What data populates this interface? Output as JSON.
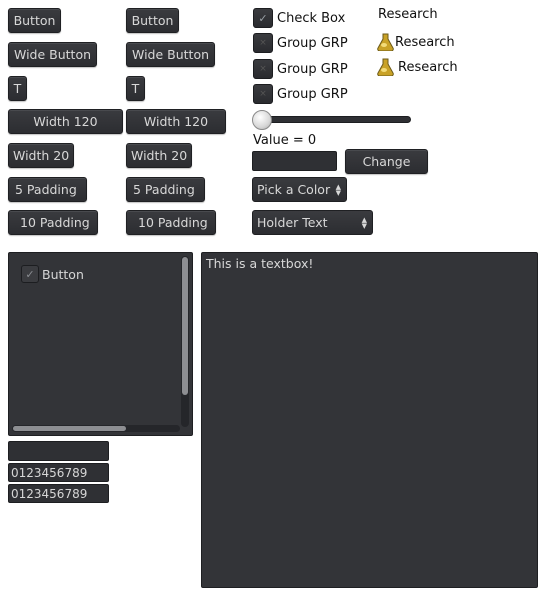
{
  "col1": {
    "button": "Button",
    "wide_button": "Wide Button",
    "t_button": "T",
    "width120": "Width 120",
    "width20": "Width 20",
    "padding5": "5 Padding",
    "padding10": "10 Padding"
  },
  "col2": {
    "button": "Button",
    "wide_button": "Wide Button",
    "t_button": "T",
    "width120": "Width 120",
    "width20": "Width 20",
    "padding5": "5 Padding",
    "padding10": "10 Padding"
  },
  "checks": {
    "checkbox_label": "Check Box",
    "group1": "Group GRP",
    "group2": "Group GRP",
    "group3": "Group GRP",
    "checkbox_checked": true,
    "group_checked": [
      false,
      false,
      false
    ]
  },
  "slider": {
    "value": 0
  },
  "value_label": "Value = 0",
  "value_input": {
    "value": ""
  },
  "change_button": "Change",
  "color_select": {
    "selected": "Pick a Color"
  },
  "holder_select": {
    "selected": "Holder Text"
  },
  "research": {
    "heading": "Research",
    "items": [
      "Research",
      "Research"
    ],
    "icon": "flask-icon"
  },
  "scrollview": {
    "check_label": "Button",
    "checked": true
  },
  "fields": {
    "field1": "",
    "field2": "0123456789",
    "field3": "0123456789"
  },
  "textbox": {
    "text": "This is a textbox!"
  }
}
